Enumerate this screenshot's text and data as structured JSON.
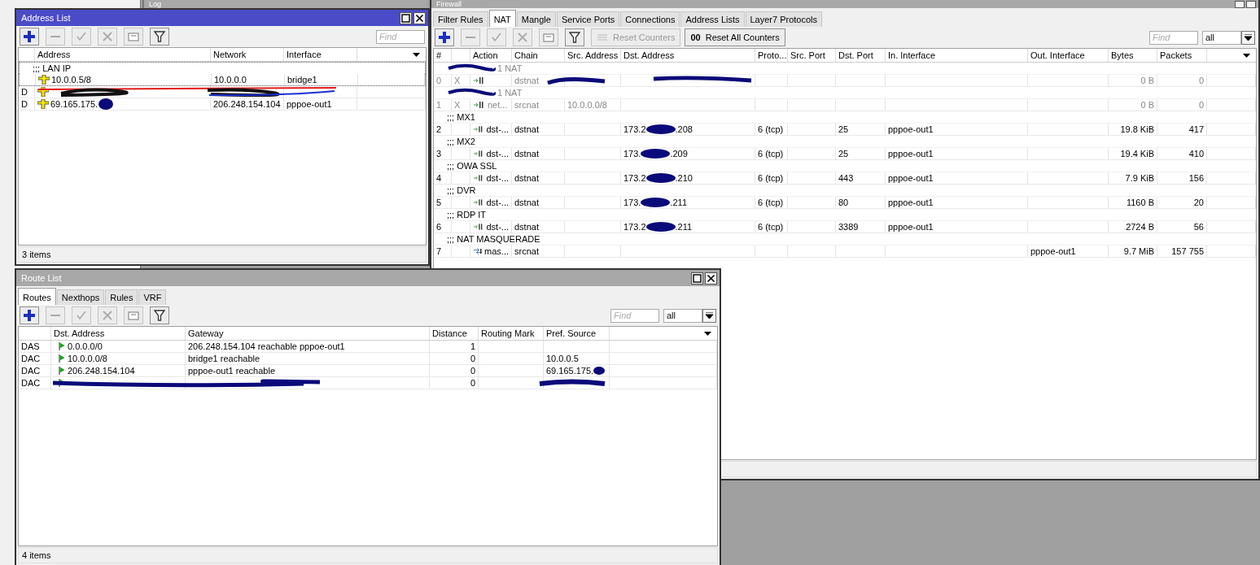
{
  "log_window": {
    "title": "Log"
  },
  "firewall": {
    "title": "Firewall",
    "tabs": [
      {
        "label": "Filter Rules",
        "selected": false
      },
      {
        "label": "NAT",
        "selected": true
      },
      {
        "label": "Mangle",
        "selected": false
      },
      {
        "label": "Service Ports",
        "selected": false
      },
      {
        "label": "Connections",
        "selected": false
      },
      {
        "label": "Address Lists",
        "selected": false
      },
      {
        "label": "Layer7 Protocols",
        "selected": false
      }
    ],
    "tools": [
      {
        "kind": "add",
        "disabled": false
      },
      {
        "kind": "remove",
        "disabled": true
      },
      {
        "kind": "enable",
        "disabled": true
      },
      {
        "kind": "disable",
        "disabled": true
      },
      {
        "kind": "comment",
        "disabled": true
      },
      {
        "kind": "filter",
        "disabled": false
      }
    ],
    "buttons": [
      {
        "label": "Reset Counters",
        "disabled": true
      },
      {
        "label": "Reset All Counters",
        "icon_text": "00",
        "disabled": false
      }
    ],
    "find_placeholder": "Find",
    "filter_value": "all",
    "columns": [
      "#",
      "Action",
      "Chain",
      "Src. Address",
      "Dst. Address",
      "Proto...",
      "Src. Port",
      "Dst. Port",
      "In. Interface",
      "Out. Interface",
      "Bytes",
      "Packets"
    ],
    "rules": [
      {
        "comment": "1 NAT",
        "comment_redacted": true,
        "number": "0",
        "flag": "X",
        "disabled": true,
        "redacted": true,
        "kind": "dstnat",
        "chain": "dstnat",
        "bytes": "0 B",
        "packets": "0"
      },
      {
        "comment": "1 NAT",
        "comment_redacted": true,
        "number": "1",
        "flag": "X",
        "disabled": true,
        "redacted": false,
        "action": "net...",
        "kind": "dstnat",
        "chain": "srcnat",
        "src_address": "10.0.0.0/8",
        "bytes": "0 B",
        "packets": "0"
      },
      {
        "comment": ";;; MX1",
        "comment_redacted": false,
        "number": "2",
        "disabled": false,
        "redacted": false,
        "action": "dst-...",
        "kind": "dstnat",
        "chain": "dstnat",
        "dst_address": {
          "start": "173.2",
          "end": ".208"
        },
        "protocol": "6 (tcp)",
        "dst_port": "25",
        "in_interface": "pppoe-out1",
        "bytes": "19.8 KiB",
        "packets": "417"
      },
      {
        "comment": ";;; MX2",
        "comment_redacted": false,
        "number": "3",
        "disabled": false,
        "redacted": false,
        "action": "dst-...",
        "kind": "dstnat",
        "chain": "dstnat",
        "dst_address": {
          "start": "173.",
          "end": ".209"
        },
        "protocol": "6 (tcp)",
        "dst_port": "25",
        "in_interface": "pppoe-out1",
        "bytes": "19.4 KiB",
        "packets": "410"
      },
      {
        "comment": ";;; OWA SSL",
        "comment_redacted": false,
        "number": "4",
        "disabled": false,
        "redacted": false,
        "action": "dst-...",
        "kind": "dstnat",
        "chain": "dstnat",
        "dst_address": {
          "start": "173.2",
          "end": ".210"
        },
        "protocol": "6 (tcp)",
        "dst_port": "443",
        "in_interface": "pppoe-out1",
        "bytes": "7.9 KiB",
        "packets": "156"
      },
      {
        "comment": ";;; DVR",
        "comment_redacted": false,
        "number": "5",
        "disabled": false,
        "redacted": false,
        "action": "dst-...",
        "kind": "dstnat",
        "chain": "dstnat",
        "dst_address": {
          "start": "173.",
          "end": ".211"
        },
        "protocol": "6 (tcp)",
        "dst_port": "80",
        "in_interface": "pppoe-out1",
        "bytes": "1160 B",
        "packets": "20"
      },
      {
        "comment": ";;; RDP IT",
        "comment_redacted": false,
        "number": "6",
        "disabled": false,
        "redacted": false,
        "action": "dst-...",
        "kind": "dstnat",
        "chain": "dstnat",
        "dst_address": {
          "start": "173.2",
          "end": ".211"
        },
        "protocol": "6 (tcp)",
        "dst_port": "3389",
        "in_interface": "pppoe-out1",
        "bytes": "2724 B",
        "packets": "56"
      },
      {
        "comment": ";;; NAT MASQUERADE",
        "comment_redacted": false,
        "number": "7",
        "disabled": false,
        "redacted": false,
        "action": "mas...",
        "kind": "masquerade",
        "chain": "srcnat",
        "out_interface": "pppoe-out1",
        "bytes": "9.7 MiB",
        "packets": "157 755"
      }
    ]
  },
  "address_list": {
    "title": "Address List",
    "active": true,
    "tools": [
      {
        "kind": "add",
        "disabled": false
      },
      {
        "kind": "remove",
        "disabled": true
      },
      {
        "kind": "enable",
        "disabled": true
      },
      {
        "kind": "disable",
        "disabled": true
      },
      {
        "kind": "comment",
        "disabled": true
      },
      {
        "kind": "filter",
        "disabled": false
      }
    ],
    "find_placeholder": "Find",
    "columns": [
      "Address",
      "Network",
      "Interface"
    ],
    "entries": [
      {
        "comment": ";;; LAN IP",
        "selected": true,
        "redacted": false,
        "address": "10.0.0.5/8",
        "network": "10.0.0.0",
        "interface": "bridge1"
      },
      {
        "selected": false,
        "flag": "D",
        "redacted": true
      },
      {
        "selected": false,
        "flag": "D",
        "redacted": false,
        "address": {
          "start": "69.165.175."
        },
        "network": "206.248.154.104",
        "interface": "pppoe-out1"
      }
    ],
    "status": "3 items"
  },
  "route_list": {
    "title": "Route List",
    "active": false,
    "tabs": [
      {
        "label": "Routes",
        "selected": true
      },
      {
        "label": "Nexthops",
        "selected": false
      },
      {
        "label": "Rules",
        "selected": false
      },
      {
        "label": "VRF",
        "selected": false
      }
    ],
    "tools": [
      {
        "kind": "add",
        "disabled": false
      },
      {
        "kind": "remove",
        "disabled": true
      },
      {
        "kind": "enable",
        "disabled": true
      },
      {
        "kind": "disable",
        "disabled": true
      },
      {
        "kind": "comment",
        "disabled": true
      },
      {
        "kind": "filter",
        "disabled": false
      }
    ],
    "find_placeholder": "Find",
    "filter_value": "all",
    "columns": [
      "Dst. Address",
      "Gateway",
      "Distance",
      "Routing Mark",
      "Pref. Source"
    ],
    "routes": [
      {
        "flag": "DAS",
        "active": true,
        "redacted": false,
        "dst_address": "0.0.0.0/0",
        "gateway": "206.248.154.104 reachable pppoe-out1",
        "distance": "1"
      },
      {
        "flag": "DAC",
        "active": true,
        "redacted": false,
        "dst_address": "10.0.0.0/8",
        "gateway": "bridge1 reachable",
        "distance": "0",
        "pref_source": "10.0.0.5"
      },
      {
        "flag": "DAC",
        "active": true,
        "redacted": false,
        "dst_address": "206.248.154.104",
        "gateway": "pppoe-out1 reachable",
        "distance": "0",
        "pref_source": {
          "start": "69.165.175."
        }
      },
      {
        "flag": "DAC",
        "active": true,
        "redacted": true,
        "distance": "0"
      }
    ],
    "status": "4 items"
  }
}
